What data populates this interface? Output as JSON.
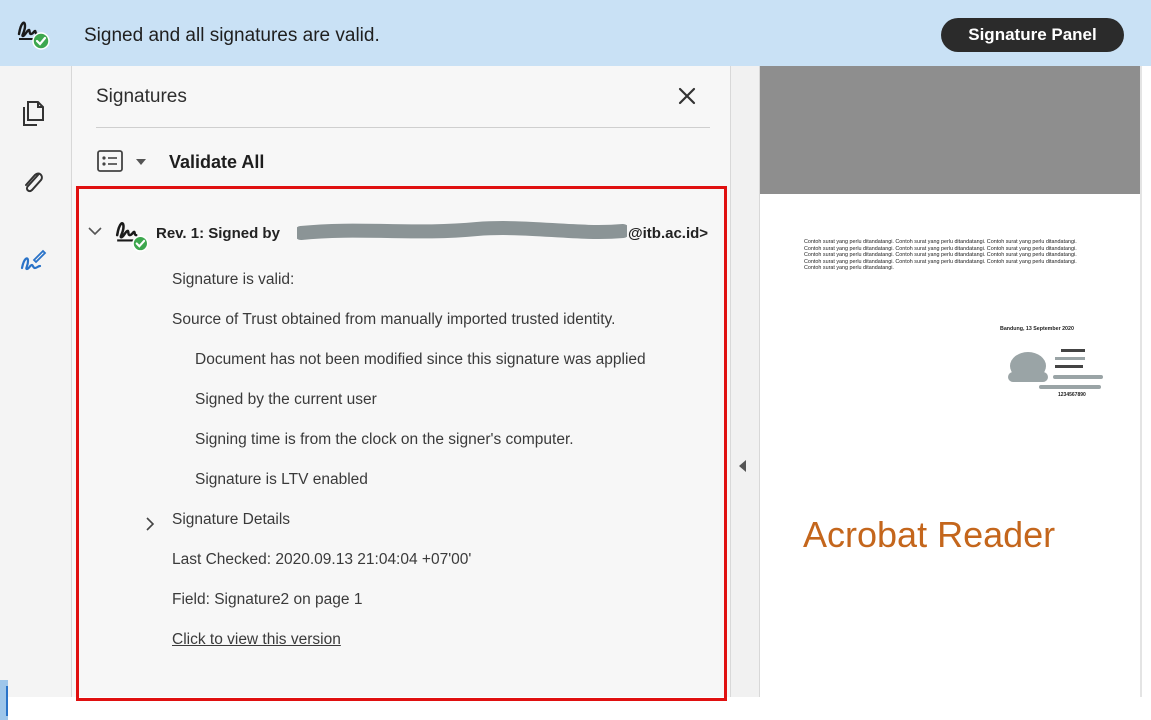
{
  "topbar": {
    "status_text": "Signed and all signatures are valid.",
    "panel_button": "Signature Panel",
    "icon": "signature-valid-icon"
  },
  "rail": {
    "icons": [
      "pages-icon",
      "attachment-icon",
      "signature-pen-icon"
    ]
  },
  "panel": {
    "title": "Signatures",
    "validate_label": "Validate All",
    "revision": {
      "label_prefix": "Rev. 1: Signed by",
      "email_suffix": "@itb.ac.id>"
    },
    "status_lines": [
      "Signature is valid:",
      "Source of Trust obtained from manually imported trusted identity."
    ],
    "detail_lines": [
      "Document has not been modified since this signature was applied",
      "Signed by the current user",
      "Signing time is from the clock on the signer's computer.",
      "Signature is LTV enabled"
    ],
    "signature_details": "Signature Details",
    "last_checked": "Last Checked: 2020.09.13 21:04:04 +07'00'",
    "field": "Field: Signature2 on page 1",
    "view_version": "Click to view this version"
  },
  "document": {
    "paragraph": "Contoh surat yang perlu ditandatangi. Contoh surat yang perlu ditandatangi. Contoh surat yang perlu ditandatangi. Contoh surat yang perlu ditandatangi. Contoh surat yang perlu ditandatangi. Contoh surat yang perlu ditandatangi. Contoh surat yang perlu ditandatangi. Contoh surat yang perlu ditandatangi. Contoh surat yang perlu ditandatangi. Contoh surat yang perlu ditandatangi. Contoh surat yang perlu ditandatangi. Contoh surat yang perlu ditandatangi. Contoh surat yang perlu ditandatangi.",
    "date": "Bandung, 13 September 2020",
    "code": "1234567890",
    "brand": "Acrobat Reader"
  },
  "colors": {
    "topbar_bg": "#c9e1f5",
    "highlight_border": "#e01010",
    "brand_text": "#c4661c",
    "valid_badge": "#3da74e"
  }
}
